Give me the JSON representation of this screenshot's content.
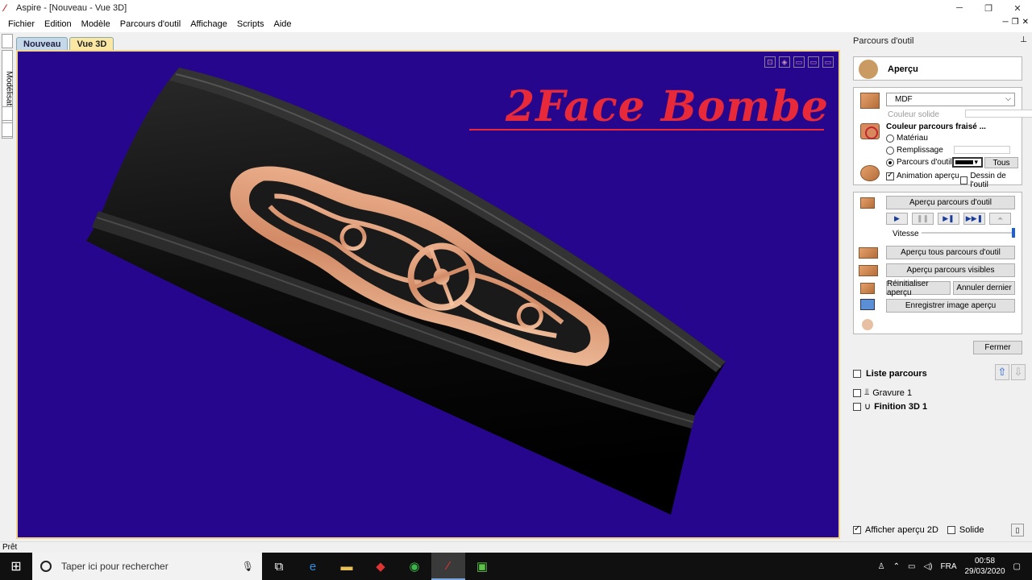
{
  "window": {
    "title": "Aspire - [Nouveau - Vue 3D]"
  },
  "menu": [
    "Fichier",
    "Edition",
    "Modèle",
    "Parcours d'outil",
    "Affichage",
    "Scripts",
    "Aide"
  ],
  "left_tab": {
    "label": "Modélisation"
  },
  "doc_tabs": [
    "Nouveau",
    "Vue 3D"
  ],
  "view": {
    "overlay_text": "2Face Bombe",
    "bg_color": "#26068c"
  },
  "panel": {
    "title": "Parcours d'outil",
    "apercu": "Aperçu",
    "material_select": "MDF",
    "couleur_solide": "Couleur solide",
    "couleur_fraise": "Couleur parcours fraisé ...",
    "radio_materiau": "Matériau",
    "radio_remplissage": "Remplissage",
    "radio_parcours": "Parcours d'outil",
    "tous": "Tous",
    "anim_apercu": "Animation aperçu",
    "dessin_outil": "Dessin de l'outil",
    "apercu_parcours": "Aperçu parcours d'outil",
    "vitesse": "Vitesse",
    "speed_fraction": 1.0,
    "apercu_tous": "Aperçu tous parcours d'outil",
    "apercu_visibles": "Aperçu parcours visibles",
    "reinit": "Réinitialiser aperçu",
    "annuler": "Annuler dernier",
    "enregistrer": "Enregistrer image aperçu",
    "fermer": "Fermer",
    "liste": "Liste parcours",
    "items": [
      "Gravure 1",
      "Finition 3D 1"
    ],
    "afficher_2d": "Afficher aperçu 2D",
    "solide": "Solide"
  },
  "status": "Prêt",
  "taskbar": {
    "search_placeholder": "Taper ici pour rechercher",
    "lang": "FRA",
    "time": "00:58",
    "date": "29/03/2020"
  }
}
